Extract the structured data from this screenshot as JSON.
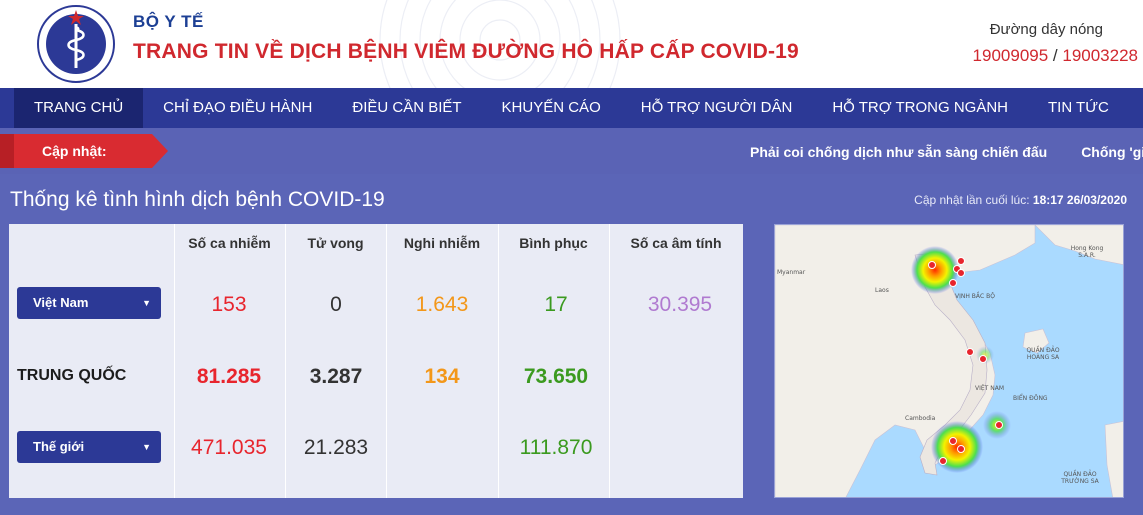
{
  "header": {
    "org_name": "BỘ Y TẾ",
    "site_title": "TRANG TIN VỀ DỊCH BỆNH VIÊM ĐƯỜNG HÔ HẤP CẤP COVID-19",
    "hotline_label": "Đường dây nóng",
    "hotline_1": "19009095",
    "hotline_sep": " / ",
    "hotline_2": "19003228",
    "logo_text": "MINISTRY OF HEALTH"
  },
  "nav": {
    "items": [
      {
        "label": "TRANG CHỦ"
      },
      {
        "label": "CHỈ ĐẠO ĐIỀU HÀNH"
      },
      {
        "label": "ĐIỀU CẦN BIẾT"
      },
      {
        "label": "KHUYẾN CÁO"
      },
      {
        "label": "HỖ TRỢ NGƯỜI DÂN"
      },
      {
        "label": "HỖ TRỢ TRONG NGÀNH"
      },
      {
        "label": "TIN TỨC"
      }
    ],
    "active_index": 0
  },
  "ticker": {
    "label": "Cập nhật:",
    "items": [
      "Phải coi chống dịch như sẵn sàng chiến đấu",
      "Chống 'giặc"
    ]
  },
  "stats": {
    "title": "Thống kê tình hình dịch bệnh COVID-19",
    "update_label": "Cập nhật lần cuối lúc:",
    "update_time": "18:17 26/03/2020",
    "columns": [
      "Số ca nhiễm",
      "Tử vong",
      "Nghi nhiễm",
      "Bình phục",
      "Số ca âm tính"
    ],
    "rows": [
      {
        "label": "Việt Nam",
        "type": "select",
        "values": [
          "153",
          "0",
          "1.643",
          "17",
          "30.395"
        ]
      },
      {
        "label": "TRUNG QUỐC",
        "type": "text",
        "values": [
          "81.285",
          "3.287",
          "134",
          "73.650",
          ""
        ]
      },
      {
        "label": "Thế giới",
        "type": "select",
        "values": [
          "471.035",
          "21.283",
          "",
          "111.870",
          ""
        ]
      }
    ]
  },
  "map": {
    "labels": {
      "myanmar": "Myanmar",
      "laos": "Laos",
      "vinh_bac_bo": "VỊNH BẮC BỘ",
      "hong_kong": "Hong Kong S.A.R.",
      "quan_dao_hoang_sa": "QUẦN ĐẢO HOÀNG SA",
      "viet_nam": "VIỆT NAM",
      "bien_dong": "BIỂN ĐÔNG",
      "cambodia": "Cambodia",
      "quan_dao_truong_sa": "QUẦN ĐẢO TRƯỜNG SA"
    },
    "colors": {
      "water": "#aadaff",
      "land": "#f2efe9",
      "hotspot": "#e8252d"
    }
  }
}
